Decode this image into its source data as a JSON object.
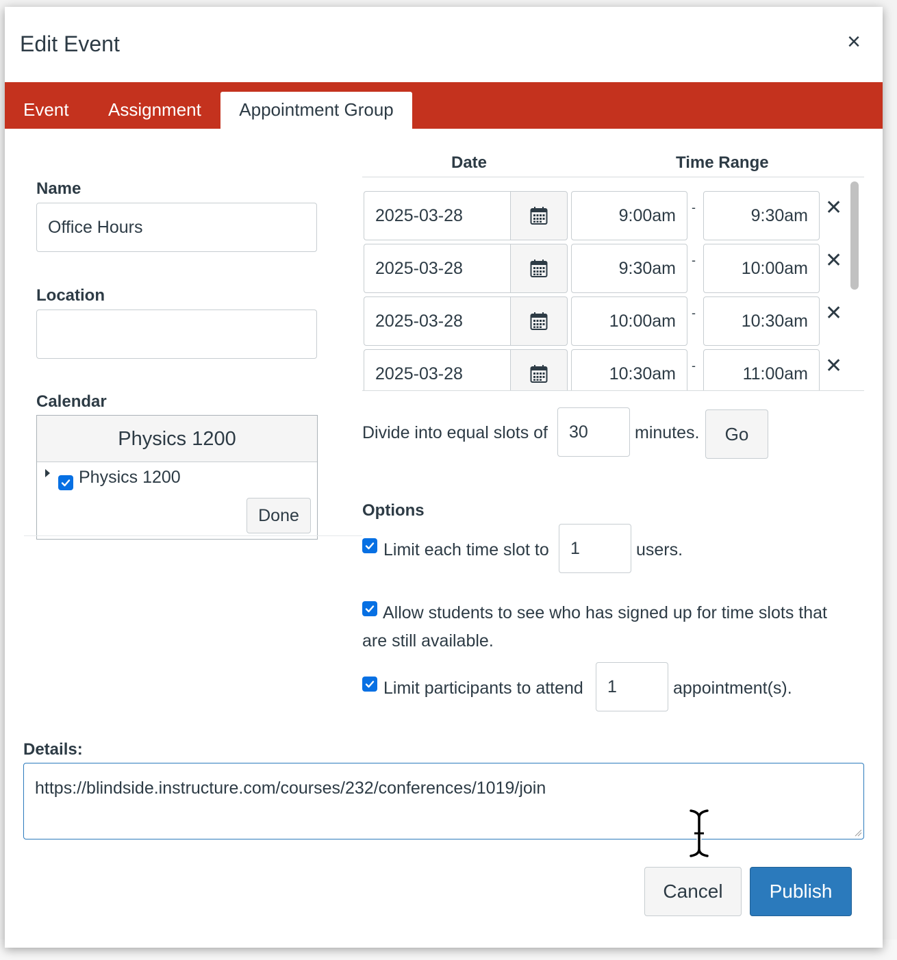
{
  "dialog": {
    "title": "Edit Event",
    "close_label": "×"
  },
  "tabs": [
    {
      "label": "Event"
    },
    {
      "label": "Assignment"
    },
    {
      "label": "Appointment Group",
      "active": true
    }
  ],
  "form": {
    "name_label": "Name",
    "name_value": "Office Hours",
    "location_label": "Location",
    "location_value": "",
    "calendar_label": "Calendar",
    "calendar_selected": "Physics 1200",
    "calendar_items": [
      {
        "label": "Physics 1200",
        "checked": true
      }
    ],
    "done_label": "Done"
  },
  "slots": {
    "date_header": "Date",
    "time_header": "Time Range",
    "separator": "-",
    "remove_label": "✕",
    "rows": [
      {
        "date": "2025-03-28",
        "start": "9:00am",
        "end": "9:30am"
      },
      {
        "date": "2025-03-28",
        "start": "9:30am",
        "end": "10:00am"
      },
      {
        "date": "2025-03-28",
        "start": "10:00am",
        "end": "10:30am"
      },
      {
        "date": "2025-03-28",
        "start": "10:30am",
        "end": "11:00am"
      }
    ]
  },
  "divide": {
    "prefix": "Divide into equal slots of",
    "value": "30",
    "suffix": "minutes.",
    "go_label": "Go"
  },
  "options": {
    "heading": "Options",
    "limit_slot_prefix": "Limit each time slot to",
    "limit_slot_value": "1",
    "limit_slot_suffix": "users.",
    "allow_see_line1": "Allow students to see who has signed up for time slots that",
    "allow_see_line2": "are still available.",
    "limit_participants_prefix": "Limit participants to attend",
    "limit_participants_value": "1",
    "limit_participants_suffix": "appointment(s)."
  },
  "details": {
    "label": "Details:",
    "value": "https://blindside.instructure.com/courses/232/conferences/1019/join"
  },
  "footer": {
    "cancel_label": "Cancel",
    "publish_label": "Publish"
  },
  "colors": {
    "tabbar": "#c4321e",
    "primary": "#2b7abc",
    "checkbox": "#0770e3"
  }
}
